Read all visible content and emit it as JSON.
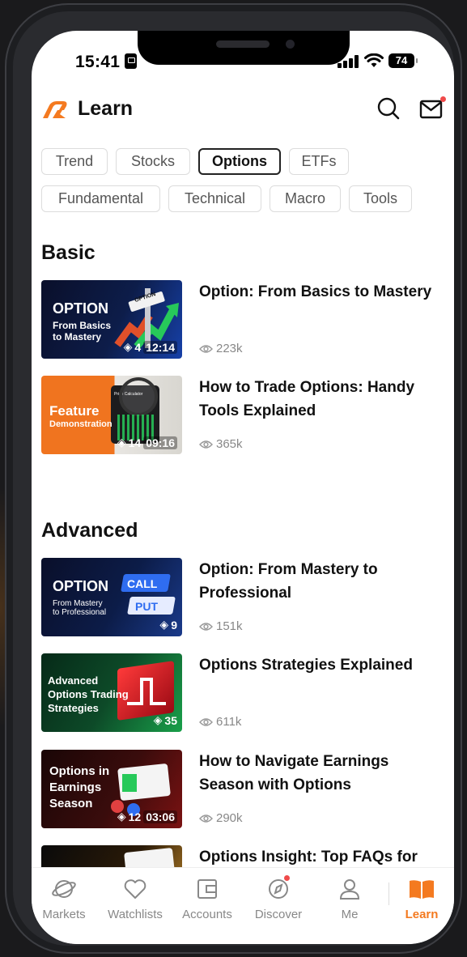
{
  "status": {
    "time": "15:41",
    "battery": "74"
  },
  "header": {
    "title": "Learn"
  },
  "filters": [
    "Trend",
    "Stocks",
    "Options",
    "ETFs",
    "Fundamental",
    "Technical",
    "Macro",
    "Tools"
  ],
  "active_filter": "Options",
  "sections": {
    "basic": {
      "title": "Basic",
      "items": [
        {
          "title": "Option: From Basics to Mastery",
          "views": "223k",
          "thumb_heading": "OPTION",
          "thumb_sub1": "From Basics",
          "thumb_sub2": "to Mastery",
          "thumb_sign": "OPTION",
          "count": "4",
          "duration": "12:14"
        },
        {
          "title": "How to Trade Options: Handy Tools Explained",
          "views": "365k",
          "thumb_heading": "Feature",
          "thumb_sub1": "Demonstration",
          "thumb_widget": "Price Calculator",
          "count": "14",
          "duration": "09:16"
        }
      ]
    },
    "advanced": {
      "title": "Advanced",
      "items": [
        {
          "title": "Option: From Mastery to Professional",
          "views": "151k",
          "thumb_heading": "OPTION",
          "thumb_sub1": "From Mastery",
          "thumb_sub2": "to Professional",
          "call": "CALL",
          "put": "PUT",
          "count": "9"
        },
        {
          "title": "Options Strategies Explained",
          "views": "611k",
          "thumb_line1": "Advanced",
          "thumb_line2": "Options Trading",
          "thumb_line3": "Strategies",
          "count": "35"
        },
        {
          "title": "How to Navigate Earnings Season with Options",
          "views": "290k",
          "thumb_line1": "Options in",
          "thumb_line2": "Earnings",
          "thumb_line3": "Season",
          "count": "12",
          "duration": "03:06"
        },
        {
          "title": "Options Insight: Top FAQs for"
        }
      ]
    }
  },
  "tabbar": [
    {
      "label": "Markets",
      "icon": "planet-icon"
    },
    {
      "label": "Watchlists",
      "icon": "heart-icon"
    },
    {
      "label": "Accounts",
      "icon": "wallet-icon"
    },
    {
      "label": "Discover",
      "icon": "compass-icon"
    },
    {
      "label": "Me",
      "icon": "person-icon"
    },
    {
      "label": "Learn",
      "icon": "book-icon"
    }
  ],
  "colors": {
    "accent": "#f47a20",
    "notification": "#f04a4a",
    "active_chip_border": "#222222"
  }
}
